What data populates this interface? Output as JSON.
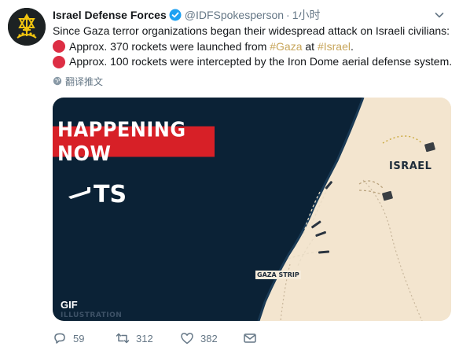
{
  "author": {
    "display_name": "Israel Defense Forces",
    "handle": "@IDFSpokesperson",
    "separator": "·",
    "time": "1小时"
  },
  "tweet": {
    "line1": "Since Gaza terror organizations began their widespread attack on Israeli civilians:",
    "line2_pre": "Approx. 370 rockets were launched from ",
    "line2_tag1": "#Gaza",
    "line2_mid": " at ",
    "line2_tag2": "#Israel",
    "line2_post": ".",
    "line3": "Approx. 100 rockets were intercepted by the Iron Dome aerial defense system."
  },
  "translate_label": "翻译推文",
  "media": {
    "banner": "HAPPENING NOW",
    "partial_text": "TS",
    "label_israel": "ISRAEL",
    "label_gaza": "GAZA STRIP",
    "gif_badge": "GIF",
    "illustration": "ILLUSTRATION"
  },
  "actions": {
    "reply_count": "59",
    "retweet_count": "312",
    "like_count": "382"
  },
  "colors": {
    "link": "#c7a55a",
    "sea": "#0b2236",
    "land": "#f3e5cf",
    "banner": "#d72027",
    "bullet": "#dd2e44"
  },
  "icons": {
    "bullet": "red-circle-icon",
    "verified": "verified-badge-icon",
    "caret": "chevron-down-icon",
    "translate": "globe-icon",
    "reply": "reply-icon",
    "retweet": "retweet-icon",
    "like": "heart-icon",
    "dm": "envelope-icon"
  }
}
